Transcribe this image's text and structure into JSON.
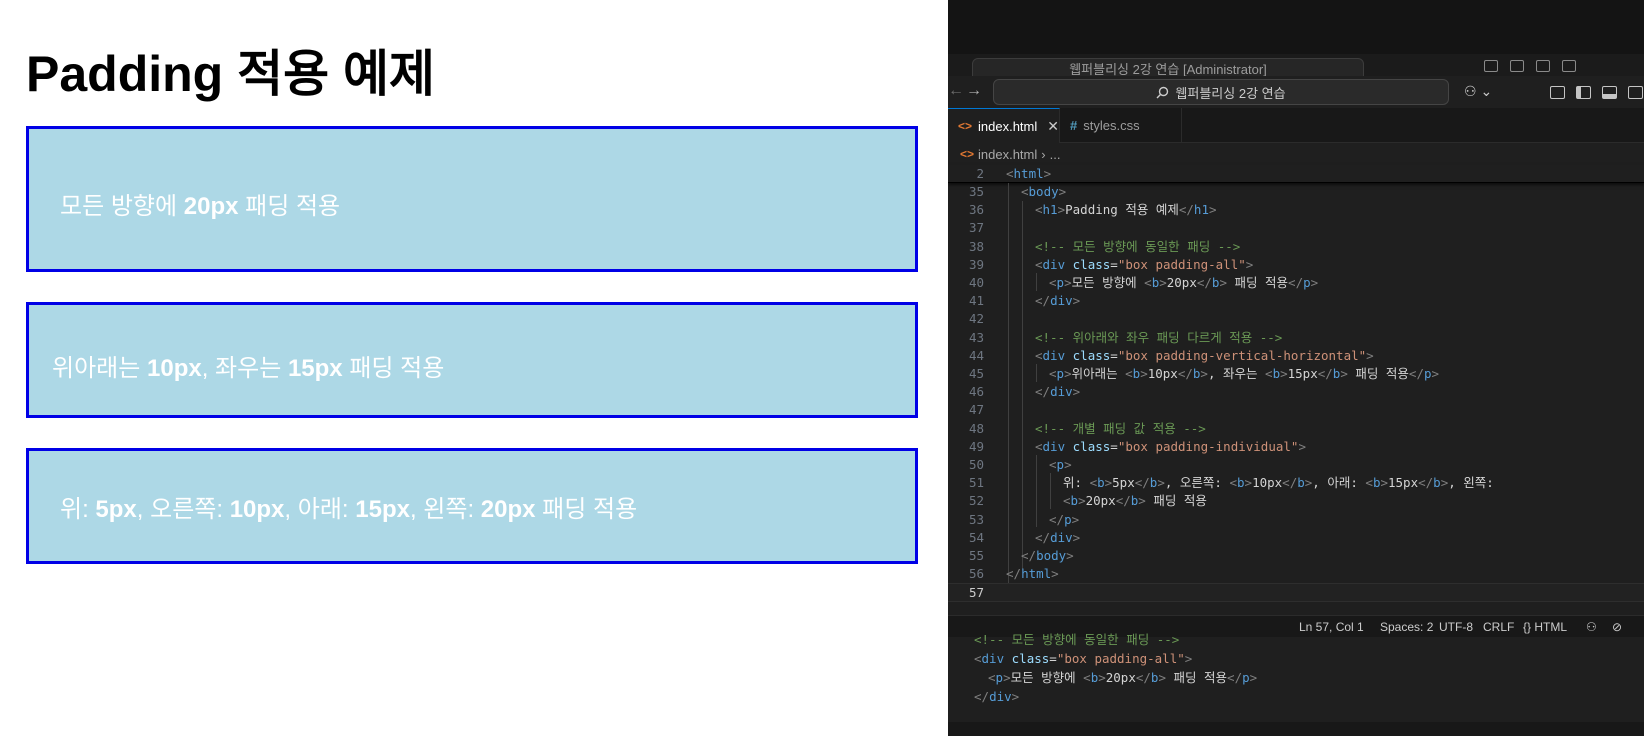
{
  "preview": {
    "title": "Padding 적용 예제",
    "box1": {
      "t1": "모든 방향에 ",
      "b1": "20px",
      "t2": " 패딩 적용"
    },
    "box2": {
      "t1": "위아래는 ",
      "b1": "10px",
      "t2": ", 좌우는 ",
      "b2": "15px",
      "t3": " 패딩 적용"
    },
    "box3": {
      "t1": "위: ",
      "b1": "5px",
      "t2": ", 오른쪽: ",
      "b2": "10px",
      "t3": ", 아래: ",
      "b3": "15px",
      "t4": ", 왼쪽: ",
      "b4": "20px",
      "t5": " 패딩 적용"
    },
    "colors": {
      "box_bg": "#add8e6",
      "box_border": "#0000e6",
      "box_text": "#ffffff"
    }
  },
  "vscode": {
    "background_title_search": "웹퍼블리싱 2강 연습 [Administrator]",
    "command_search": "웹퍼블리싱 2강 연습",
    "tabs": [
      {
        "label": "index.html",
        "icon": "html-file-icon",
        "active": true
      },
      {
        "label": "styles.css",
        "icon": "css-file-icon",
        "active": false
      }
    ],
    "breadcrumb": {
      "file": "index.html",
      "sep": "›",
      "rest": "..."
    },
    "sticky": {
      "num": "2",
      "html_tag": "html"
    },
    "line_numbers": [
      "35",
      "36",
      "37",
      "38",
      "39",
      "40",
      "41",
      "42",
      "43",
      "44",
      "45",
      "46",
      "47",
      "48",
      "49",
      "50",
      "51",
      "52",
      "53",
      "54",
      "55",
      "56",
      "57"
    ],
    "code": {
      "tag_body": "body",
      "tag_h1": "h1",
      "h1_text": "Padding 적용 예제",
      "comment1": "<!-- 모든 방향에 동일한 패딩 -->",
      "tag_div": "div",
      "attr_class": "class",
      "class1": "\"box padding-all\"",
      "tag_p": "p",
      "tag_b": "b",
      "p1_t1": "모든 방향에 ",
      "p1_b1": "20px",
      "p1_t2": " 패딩 적용",
      "comment2": "<!-- 위아래와 좌우 패딩 다르게 적용 -->",
      "class2": "\"box padding-vertical-horizontal\"",
      "p2_t1": "위아래는 ",
      "p2_b1": "10px",
      "p2_t2": ", 좌우는 ",
      "p2_b2": "15px",
      "p2_t3": " 패딩 적용",
      "comment3": "<!-- 개별 패딩 값 적용 -->",
      "class3": "\"box padding-individual\"",
      "p3_t1": "위: ",
      "p3_b1": "5px",
      "p3_t2": ", 오른쪽: ",
      "p3_b2": "10px",
      "p3_t3": ", 아래: ",
      "p3_b3": "15px",
      "p3_t4": ", 왼쪽:",
      "p3_b4": "20px",
      "p3_t5": " 패딩 적용",
      "tag_html": "html"
    },
    "status": {
      "position": "Ln 57, Col 1",
      "spaces": "Spaces: 2",
      "encoding": "UTF-8",
      "eol": "CRLF",
      "language": "{} HTML"
    },
    "bg_code": {
      "comment": "<!-- 모든 방향에 동일한 패딩 -->",
      "class_value": "\"box padding-all\""
    }
  }
}
